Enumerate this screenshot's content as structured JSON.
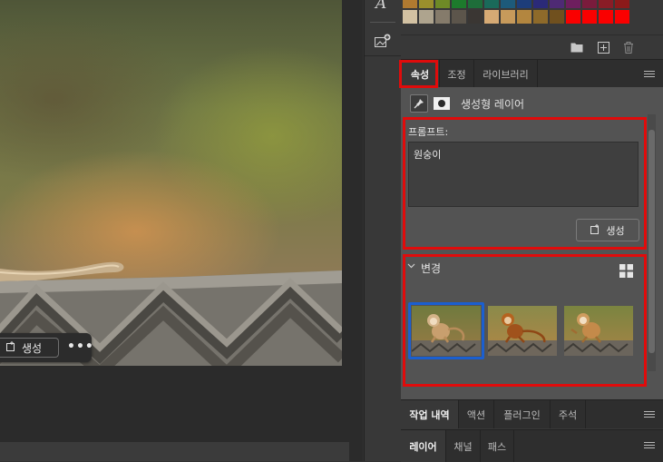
{
  "canvas": {
    "task_bar": {
      "generate_label": "생성",
      "more_label": "•••"
    }
  },
  "tool_strip": {
    "type_tool_glyph": "A",
    "icons": [
      "type-tool-icon",
      "generative-layer-icon"
    ]
  },
  "swatches": {
    "colors": [
      [
        "#b07a30",
        "#9a8f2c",
        "#6e8a26",
        "#1d7a2c",
        "#1e6d3a",
        "#1a6a5a",
        "#1d5a7a",
        "#1d3d7a",
        "#2b2a78",
        "#4e2a74",
        "#6e1e5e",
        "#7a1b3c",
        "#8a1c26",
        "#8c1a1a"
      ],
      [
        "#d2c1a2",
        "#aea48e",
        "#857b6b",
        "#5c554b",
        "#3a3633",
        "#d6aa74",
        "#c79a5b",
        "#b3863f",
        "#8e6a2a",
        "#70501e",
        "#fa0000",
        "#fa0000",
        "#fa0000",
        "#fa0000"
      ]
    ],
    "toolbar_icons": [
      "folder-icon",
      "new-swatch-icon",
      "trash-icon"
    ]
  },
  "properties": {
    "tabs": [
      {
        "label": "속성",
        "active": true
      },
      {
        "label": "조정",
        "active": false
      },
      {
        "label": "라이브러리",
        "active": false
      }
    ],
    "layer_type_label": "생성형 레이어",
    "prompt": {
      "label": "프롬프트:",
      "value": "원숭이",
      "generate_label": "생성"
    },
    "variations": {
      "title": "변경",
      "thumbnails": [
        {
          "name": "variation-1",
          "selected": true
        },
        {
          "name": "variation-2",
          "selected": false
        },
        {
          "name": "variation-3",
          "selected": false
        }
      ]
    }
  },
  "history_panel": {
    "tabs": [
      {
        "label": "작업 내역",
        "active": true
      },
      {
        "label": "액션",
        "active": false
      },
      {
        "label": "플러그인",
        "active": false
      },
      {
        "label": "주석",
        "active": false
      }
    ]
  },
  "layers_panel": {
    "tabs": [
      {
        "label": "레이어",
        "active": true
      },
      {
        "label": "채널",
        "active": false
      },
      {
        "label": "패스",
        "active": false
      }
    ]
  },
  "colors": {
    "highlight_red": "#e00b0b",
    "selection_blue": "#1b5fd0",
    "panel_bg": "#535353",
    "tab_bg": "#2e2e2e"
  }
}
